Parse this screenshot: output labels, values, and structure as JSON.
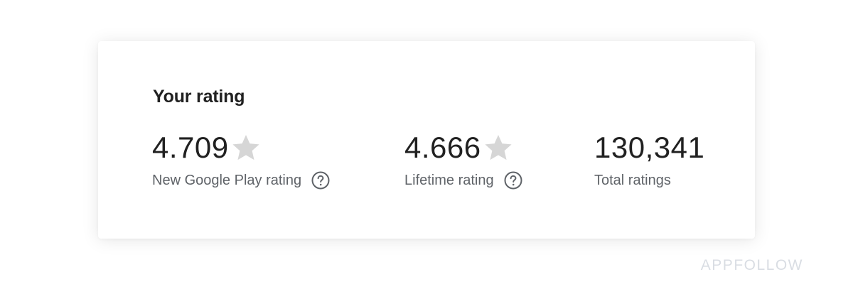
{
  "card": {
    "title": "Your rating"
  },
  "metrics": [
    {
      "value": "4.709",
      "label": "New Google Play rating",
      "has_star": true,
      "has_help": true
    },
    {
      "value": "4.666",
      "label": "Lifetime rating",
      "has_star": true,
      "has_help": true
    },
    {
      "value": "130,341",
      "label": "Total ratings",
      "has_star": false,
      "has_help": false
    }
  ],
  "icons": {
    "star": "star-icon",
    "help": "help-circle-icon"
  },
  "colors": {
    "text_primary": "#212121",
    "text_secondary": "#5f6368",
    "star": "#d6d6d6",
    "watermark": "#d9dde3"
  },
  "watermark": "APPFOLLOW"
}
